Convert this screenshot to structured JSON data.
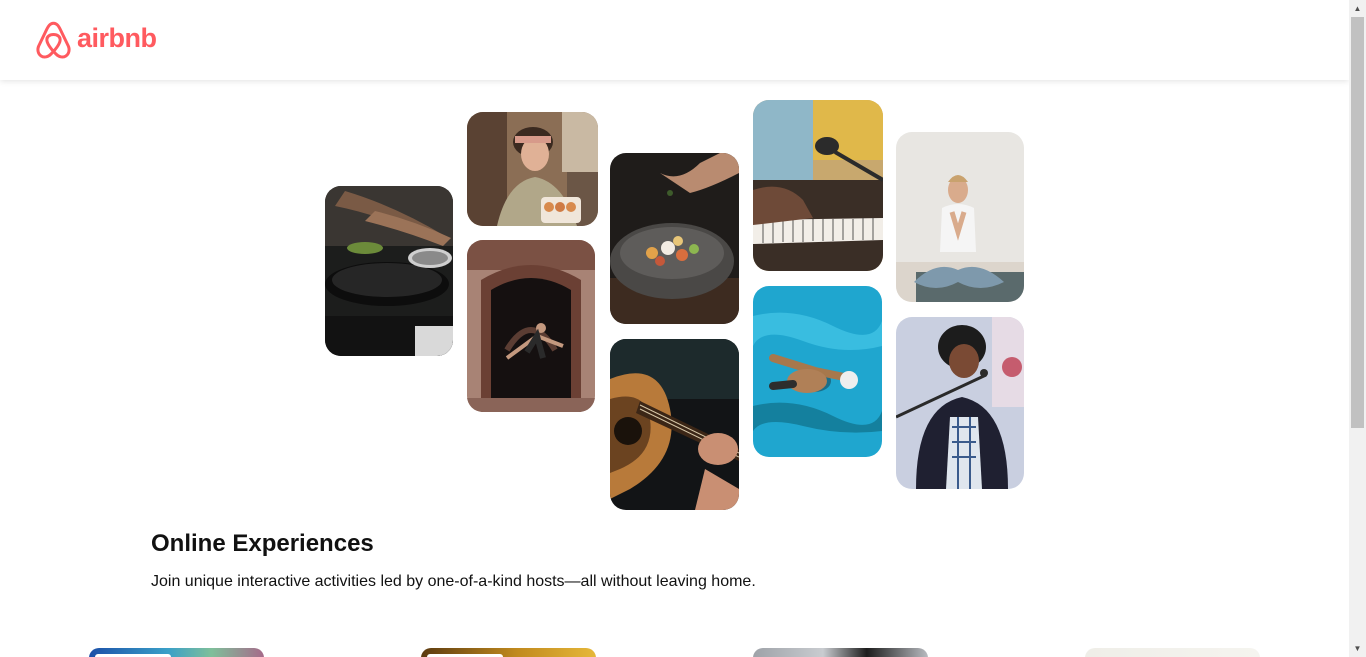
{
  "brand": {
    "name": "airbnb",
    "color": "#FF5A5F",
    "logo_icon": "belo-icon"
  },
  "collage": [
    {
      "id": "cooking-pans",
      "subject": "cooking-photo"
    },
    {
      "id": "baker",
      "subject": "baker-photo"
    },
    {
      "id": "dancer",
      "subject": "dancer-photo"
    },
    {
      "id": "food-bowl",
      "subject": "food-bowl-photo"
    },
    {
      "id": "guitar",
      "subject": "guitar-photo"
    },
    {
      "id": "keyboard-mic",
      "subject": "keyboard-photo"
    },
    {
      "id": "swimmer",
      "subject": "swimmer-photo"
    },
    {
      "id": "yoga",
      "subject": "yoga-photo"
    },
    {
      "id": "singer",
      "subject": "singer-photo"
    }
  ],
  "intro": {
    "title": "Online Experiences",
    "subtitle": "Join unique interactive activities led by one-of-a-kind hosts—all without leaving home."
  },
  "scrollbar": {
    "up_icon": "scroll-up-arrow-icon",
    "down_icon": "scroll-down-arrow-icon"
  }
}
